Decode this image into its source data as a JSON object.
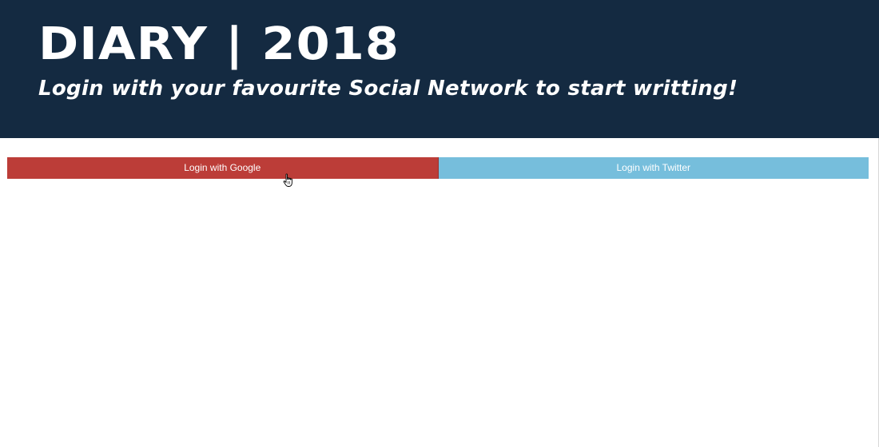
{
  "header": {
    "title": "DIARY | 2018",
    "subtitle": "Login with your favourite Social Network to start writting!"
  },
  "login": {
    "google_label": "Login with Google",
    "twitter_label": "Login with Twitter"
  },
  "colors": {
    "header_bg": "#142a41",
    "google": "#bc3d38",
    "twitter": "#76bedc",
    "text": "#ffffff"
  },
  "icons": {
    "cursor": "hand-pointer-icon"
  }
}
